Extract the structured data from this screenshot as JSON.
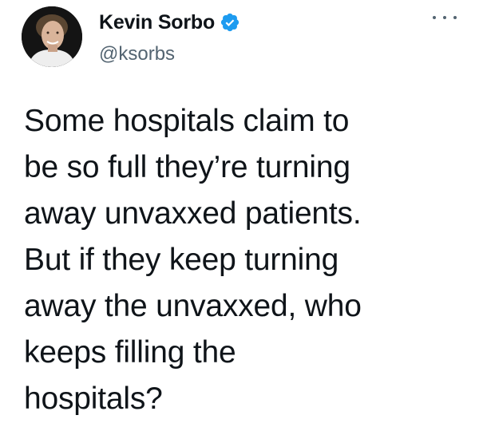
{
  "tweet": {
    "author": {
      "display_name": "Kevin Sorbo",
      "handle": "@ksorbs",
      "verified": true,
      "avatar_icon": "avatar-photo"
    },
    "more_icon": "more-horizontal-icon",
    "text": "Some hospitals claim to\nbe so full they’re turning\naway unvaxxed patients.\nBut if they keep turning\naway the unvaxxed, who\nkeeps filling the\nhospitals?"
  },
  "colors": {
    "text": "#0f1419",
    "secondary": "#536471",
    "verified_badge": "#1d9bf0",
    "background": "#ffffff"
  }
}
